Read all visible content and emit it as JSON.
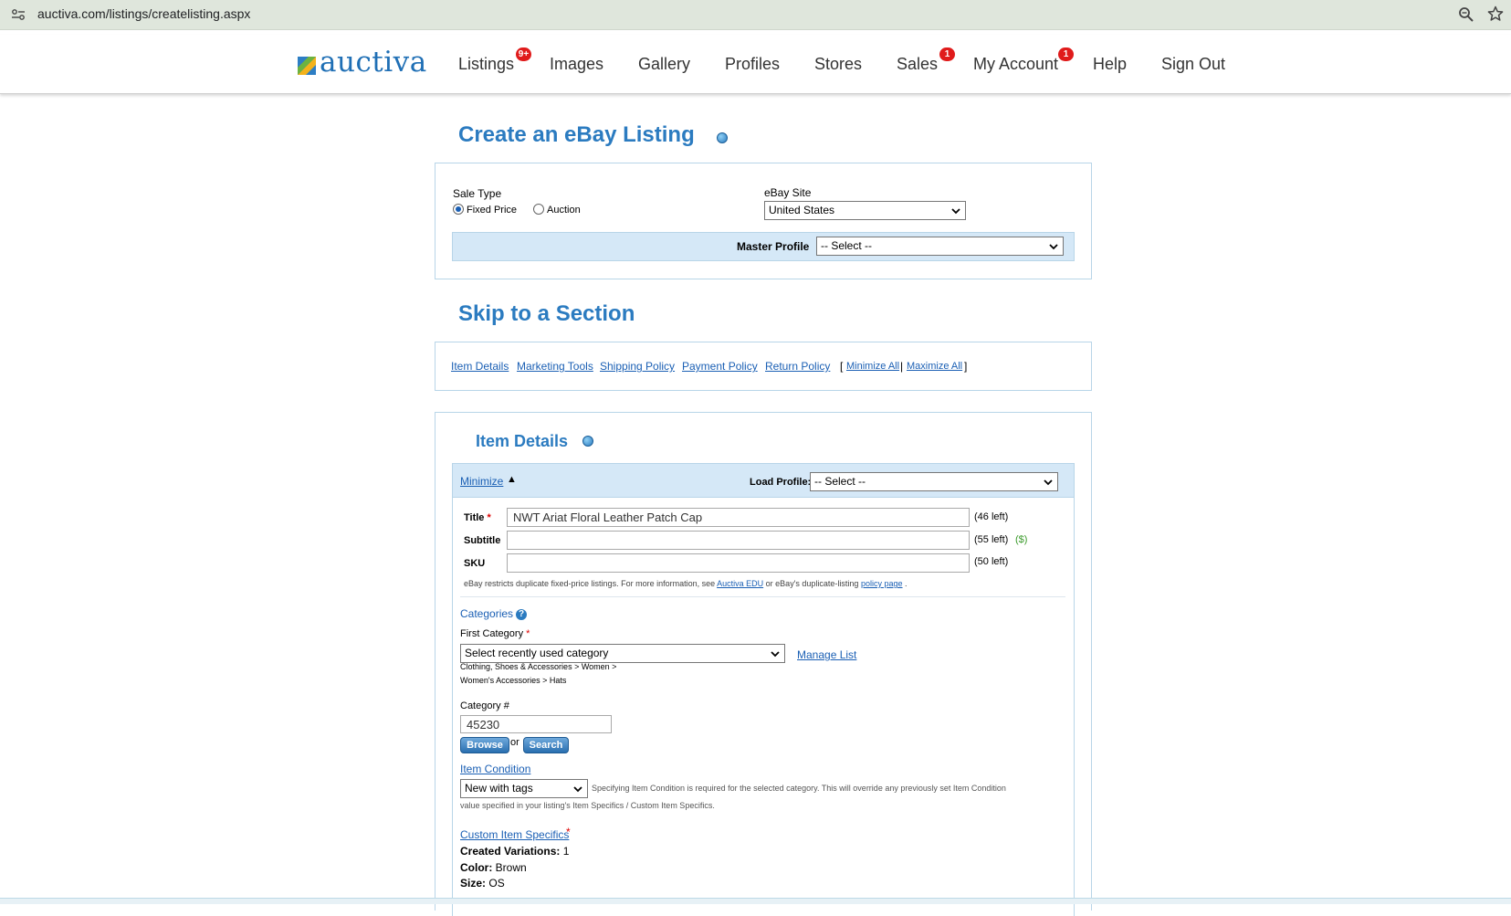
{
  "browser": {
    "url": "auctiva.com/listings/createlisting.aspx"
  },
  "header": {
    "logo_text": "auctiva",
    "nav": [
      {
        "label": "Listings",
        "badge": "9+"
      },
      {
        "label": "Images"
      },
      {
        "label": "Gallery"
      },
      {
        "label": "Profiles"
      },
      {
        "label": "Stores"
      },
      {
        "label": "Sales",
        "badge": "1"
      },
      {
        "label": "My Account",
        "badge": "1"
      },
      {
        "label": "Help"
      },
      {
        "label": "Sign Out"
      }
    ]
  },
  "create": {
    "title": "Create an eBay Listing",
    "sale_type_label": "Sale Type",
    "fixed_price": "Fixed Price",
    "auction": "Auction",
    "ebay_site_label": "eBay Site",
    "ebay_site_value": "United States",
    "master_profile_label": "Master Profile",
    "master_profile_value": "-- Select --"
  },
  "skip": {
    "title": "Skip to a Section",
    "links": [
      "Item Details",
      "Marketing Tools",
      "Shipping Policy",
      "Payment Policy",
      "Return Policy"
    ],
    "bracket_open": "[",
    "minimize_all": "Minimize All",
    "sep": "|",
    "maximize_all": "Maximize All",
    "bracket_close": "]"
  },
  "item": {
    "title": "Item Details",
    "minimize": "Minimize",
    "minimize_arrow": "▲",
    "load_profile_label": "Load Profile:",
    "load_profile_value": "-- Select --",
    "title_label": "Title",
    "title_value": "NWT Ariat Floral Leather Patch Cap",
    "title_left": "(46 left)",
    "subtitle_label": "Subtitle",
    "subtitle_left": "(55 left)",
    "subtitle_fee": "($)",
    "sku_label": "SKU",
    "sku_left": "(50 left)",
    "dup_note_1": "eBay restricts duplicate fixed-price listings. For more information, see",
    "dup_link_1": "Auctiva EDU",
    "dup_note_2": "or eBay's duplicate-listing",
    "dup_link_2": "policy page",
    "dup_note_3": ".",
    "categories_label": "Categories",
    "first_category_label": "First Category",
    "category_select_value": "Select recently used category",
    "manage_list": "Manage List",
    "category_path_1": "Clothing, Shoes & Accessories > Women >",
    "category_path_2": "Women's Accessories > Hats",
    "category_num_label": "Category #",
    "category_num_value": "45230",
    "browse": "Browse",
    "or": "or",
    "search": "Search",
    "condition_label": "Item Condition",
    "condition_value": "New with tags",
    "condition_note_1": "Specifying Item Condition is required for the selected category. This will override any previously set Item Condition",
    "condition_note_2": "value specified in your listing's Item Specifics / Custom Item Specifics.",
    "custom_specifics": "Custom Item Specifics",
    "created_variations_label": "Created Variations:",
    "created_variations_value": "1",
    "color_label": "Color:",
    "color_value": "Brown",
    "size_label": "Size:",
    "size_value": "OS",
    "required_mark": "*",
    "help_mark": "?"
  }
}
